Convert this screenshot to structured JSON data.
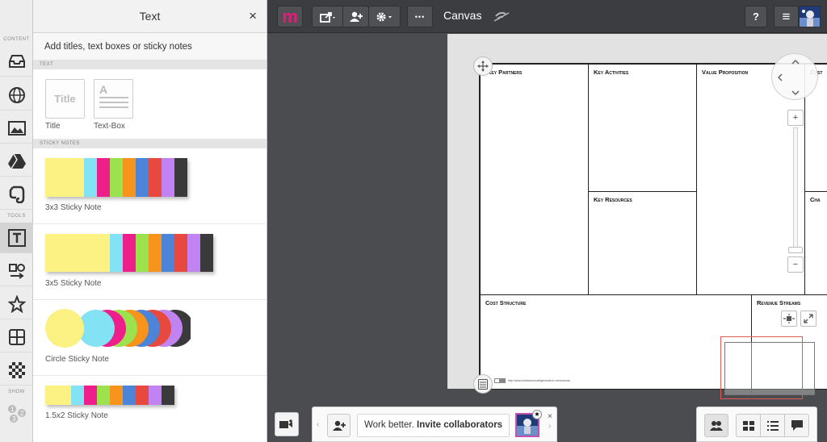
{
  "rail": {
    "content_label": "CONTENT",
    "tools_label": "TOOLS",
    "show_label": "SHOW"
  },
  "panel": {
    "title": "Text",
    "close": "×",
    "subtitle": "Add titles, text boxes or sticky notes",
    "text_section": "TEXT",
    "sticky_section": "STICKY NOTES",
    "text_tiles": [
      {
        "label": "Title",
        "preview": "Title"
      },
      {
        "label": "Text-Box",
        "preview": "A"
      }
    ],
    "sticky_items": [
      {
        "label": "3x3 Sticky Note"
      },
      {
        "label": "3x5 Sticky Note"
      },
      {
        "label": "Circle Sticky Note"
      },
      {
        "label": "1.5x2 Sticky Note"
      }
    ]
  },
  "topbar": {
    "logo": "m",
    "canvas_title": "Canvas",
    "more": "•••",
    "help": "?",
    "menu": "≡"
  },
  "board": {
    "cells": {
      "key_partners": "Key Partners",
      "key_activities": "Key Activities",
      "value_proposition": "Value Proposition",
      "customer_relationships": "Cust",
      "key_resources": "Key Resources",
      "channels": "Cha",
      "cost_structure": "Cost Structure",
      "revenue_streams": "Revenue Streams"
    },
    "credit": "http://www.businessmodelgeneration.com/canvas"
  },
  "zoom": {
    "plus": "+",
    "minus": "−",
    "level": 0.9
  },
  "bottom": {
    "invite_text": "Work better.",
    "invite_bold": "Invite collaborators",
    "close": "×"
  },
  "colors": {
    "accent": "#e6197d",
    "sticky": [
      "#fbf283",
      "#83e2f4",
      "#ee1e8b",
      "#9ce24e",
      "#f7941d",
      "#4c84d8",
      "#e8493f",
      "#c183f2",
      "#3a3a3a"
    ]
  }
}
